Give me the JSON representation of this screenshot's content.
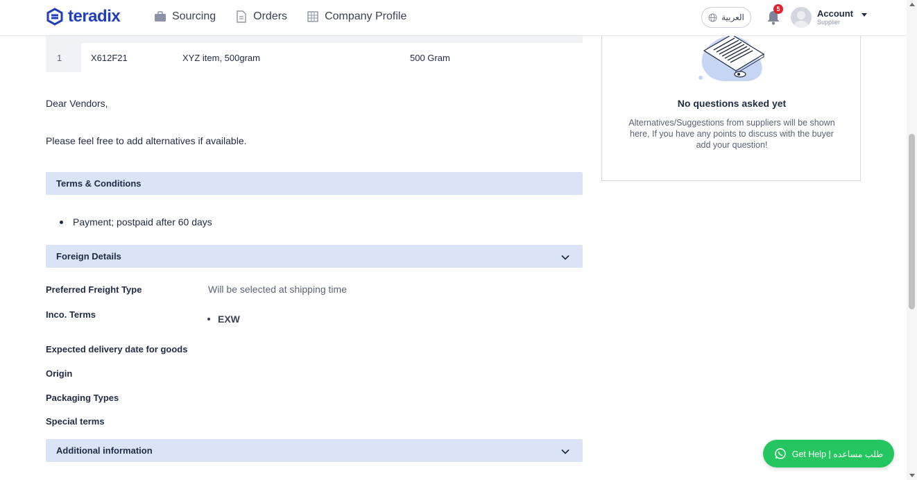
{
  "header": {
    "brand": "teradix",
    "nav": [
      {
        "label": "Sourcing",
        "icon": "briefcase-icon"
      },
      {
        "label": "Orders",
        "icon": "document-icon"
      },
      {
        "label": "Company Profile",
        "icon": "building-icon"
      }
    ],
    "language_label": "العربية",
    "notification_count": "5",
    "account_name": "Account",
    "account_role": "Supplier"
  },
  "items_table": {
    "rows": [
      {
        "num": "1",
        "code": "X612F21",
        "description": "XYZ item, 500gram",
        "quantity": "500 Gram"
      }
    ]
  },
  "notes": {
    "greeting": "Dear Vendors,",
    "message": "Please feel free to add alternatives if available."
  },
  "terms": {
    "title": "Terms & Conditions",
    "items": [
      "Payment; postpaid after 60 days"
    ]
  },
  "foreign_details": {
    "title": "Foreign Details",
    "fields": [
      {
        "label": "Preferred Freight Type",
        "value": "Will be selected at shipping time"
      },
      {
        "label": "Inco. Terms",
        "value": "EXW"
      },
      {
        "label": "Expected delivery date for goods",
        "value": ""
      },
      {
        "label": "Origin",
        "value": ""
      },
      {
        "label": "Packaging Types",
        "value": ""
      },
      {
        "label": "Special terms",
        "value": ""
      }
    ]
  },
  "additional_info": {
    "title": "Additional information"
  },
  "questions_panel": {
    "title": "No questions asked yet",
    "description": "Alternatives/Suggestions from suppliers will be shown here, If you have any points to discuss with the buyer add your question!"
  },
  "help_button": {
    "label": "Get Help | طلب مساعده"
  },
  "colors": {
    "brand": "#1f3fbf",
    "section_bar": "#dbe4f6",
    "help_green": "#25c65f",
    "badge_red": "#e0202a"
  }
}
